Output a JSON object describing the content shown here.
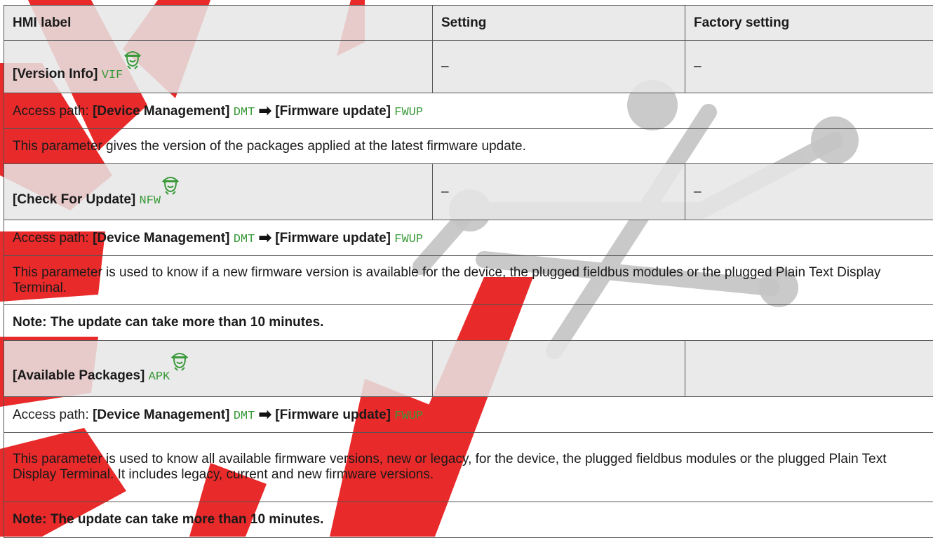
{
  "colors": {
    "code_green": "#3a9a3a",
    "watermark_red": "#e81f1f",
    "watermark_gray": "#bfbfbf"
  },
  "table": {
    "headers": {
      "hmi_label": "HMI label",
      "setting": "Setting",
      "factory_setting": "Factory setting"
    },
    "params": [
      {
        "label": "[Version Info]",
        "code": "VIF",
        "icon": "technician-icon",
        "setting": "–",
        "factory": "–",
        "access": {
          "prefix": "Access path: ",
          "menu1": "[Device Management]",
          "code1": "DMT",
          "menu2": "[Firmware update]",
          "code2": "FWUP"
        },
        "description": [
          "This parameter gives the version of the packages applied at the latest firmware update."
        ]
      },
      {
        "label": "[Check For Update]",
        "code": "NFW",
        "icon": "technician-icon",
        "setting": "–",
        "factory": "–",
        "access": {
          "prefix": "Access path: ",
          "menu1": "[Device Management]",
          "code1": "DMT",
          "menu2": "[Firmware update]",
          "code2": "FWUP"
        },
        "description": [
          "This parameter is used to know if a new firmware version is available for the device, the plugged fieldbus modules or the plugged Plain Text Display Terminal."
        ],
        "note": "Note: The update can take more than 10 minutes."
      },
      {
        "label": "[Available Packages]",
        "code": "APK",
        "icon": "technician-icon",
        "setting": "",
        "factory": "",
        "access": {
          "prefix": "Access path: ",
          "menu1": "[Device Management]",
          "code1": "DMT",
          "menu2": "[Firmware update]",
          "code2": "FWUP"
        },
        "description": [
          "This parameter is used to know all available firmware versions, new or legacy, for the device, the plugged fieldbus modules or the plugged Plain Text Display Terminal. It includes legacy, current and new firmware versions."
        ],
        "note": "Note: The update can take more than 10 minutes."
      }
    ]
  }
}
